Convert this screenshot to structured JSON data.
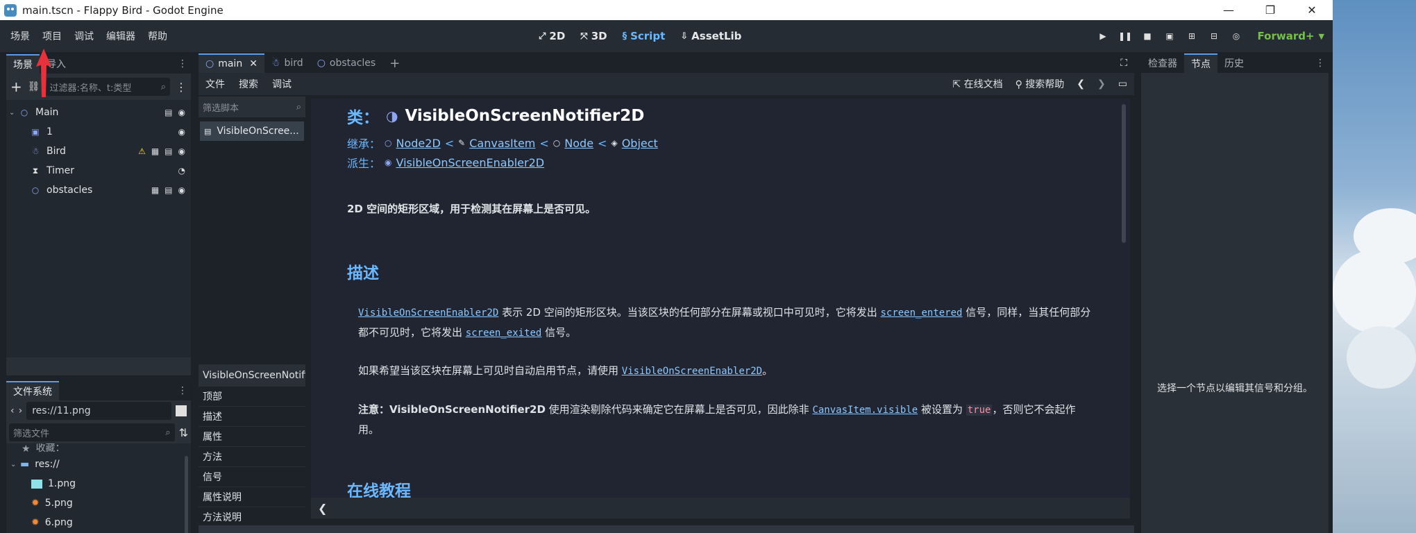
{
  "window": {
    "title": "main.tscn - Flappy Bird - Godot Engine",
    "controls": [
      "—",
      "❐",
      "✕"
    ]
  },
  "menu": [
    "场景",
    "项目",
    "调试",
    "编辑器",
    "帮助"
  ],
  "modes": [
    {
      "label": "2D",
      "icon": "2d-icon"
    },
    {
      "label": "3D",
      "icon": "3d-icon"
    },
    {
      "label": "Script",
      "icon": "script-icon"
    },
    {
      "label": "AssetLib",
      "icon": "assetlib-icon"
    }
  ],
  "renderer": "Forward+",
  "scene_dock": {
    "tabs": [
      "场景",
      "导入"
    ],
    "filter_placeholder": "过滤器:名称、t:类型",
    "nodes": [
      {
        "name": "Main",
        "icon": "node2d-icon"
      },
      {
        "name": "1",
        "icon": "sprite-icon"
      },
      {
        "name": "Bird",
        "icon": "character-icon"
      },
      {
        "name": "Timer",
        "icon": "timer-icon"
      },
      {
        "name": "obstacles",
        "icon": "node2d-icon"
      }
    ]
  },
  "filesystem": {
    "tab": "文件系统",
    "path": "res://11.png",
    "filter_placeholder": "筛选文件",
    "items": [
      "收藏：",
      "res://",
      "1.png",
      "5.png",
      "6.png"
    ]
  },
  "scene_tabs": [
    "main",
    "bird",
    "obstacles"
  ],
  "script_menu": [
    "文件",
    "搜索",
    "调试"
  ],
  "script_right": [
    "在线文档",
    "搜索帮助"
  ],
  "script_list": {
    "filter_placeholder": "筛选脚本",
    "item": "VisibleOnScree..."
  },
  "outline": {
    "header": "VisibleOnScreenNotifi",
    "items": [
      "顶部",
      "描述",
      "属性",
      "方法",
      "信号",
      "属性说明",
      "方法说明"
    ]
  },
  "doc": {
    "class_label": "类：",
    "class_name": "VisibleOnScreenNotifier2D",
    "inherits_label": "继承：",
    "inherits": [
      "Node2D",
      "CanvasItem",
      "Node",
      "Object"
    ],
    "inherits_sep": "<",
    "derived_label": "派生：",
    "derived": "VisibleOnScreenEnabler2D",
    "brief": "2D 空间的矩形区域，用于检测其在屏幕上是否可见。",
    "desc_heading": "描述",
    "p1_link": "VisibleOnScreenEnabler2D",
    "p1_a": " 表示 2D 空间的矩形区块。当该区块的任何部分在屏幕或视口中可见时，它将发出 ",
    "p1_sig1": "screen_entered",
    "p1_b": " 信号，同样，当其任何部分都不可见时，它将发出 ",
    "p1_sig2": "screen_exited",
    "p1_c": " 信号。",
    "p2_a": "如果希望当该区块在屏幕上可见时自动启用节点，请使用 ",
    "p2_link": "VisibleOnScreenEnabler2D",
    "p2_b": "。",
    "p3_bold": "注意：VisibleOnScreenNotifier2D",
    "p3_a": " 使用渲染剔除代码来确定它在屏幕上是否可见，因此除非 ",
    "p3_code": "CanvasItem.visible",
    "p3_b": " 被设置为 ",
    "p3_true": "true",
    "p3_c": "，否则它不会起作用。",
    "tutorial_heading": "在线教程"
  },
  "inspector_dock": {
    "tabs": [
      "检查器",
      "节点",
      "历史"
    ],
    "message": "选择一个节点以编辑其信号和分组。"
  },
  "colors": {
    "accent": "#6bb8ff",
    "renderer": "#76c04b",
    "warning": "#ffdd33",
    "arrow": "#e8313a"
  }
}
